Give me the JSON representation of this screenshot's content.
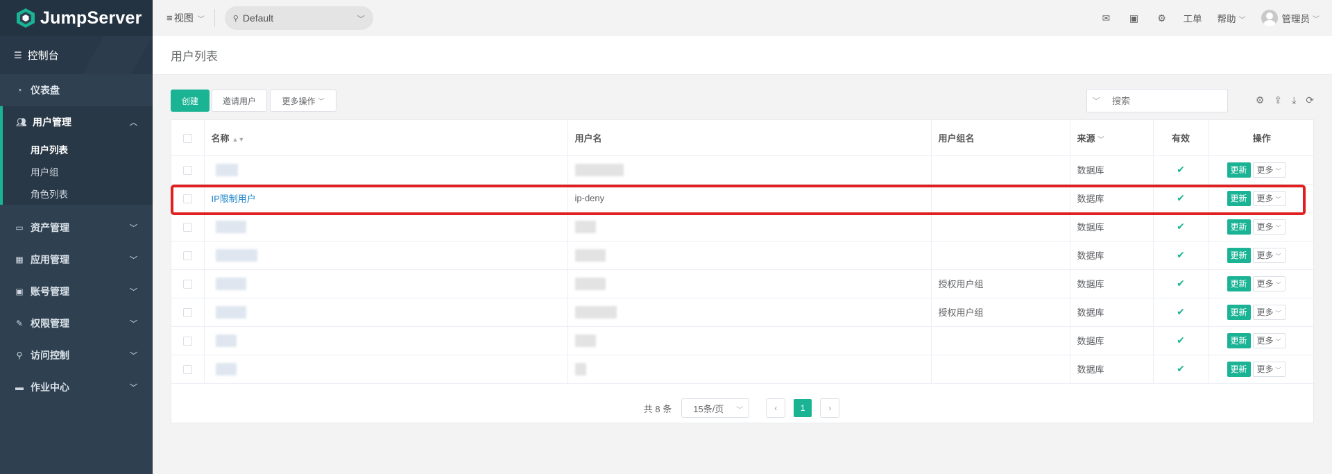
{
  "app": {
    "name": "JumpServer"
  },
  "sidebar": {
    "console": "控制台",
    "items": [
      {
        "label": "仪表盘",
        "icon": "dashboard-icon"
      },
      {
        "label": "用户管理",
        "icon": "users-icon",
        "open": true,
        "children": [
          {
            "label": "用户列表",
            "active": true
          },
          {
            "label": "用户组"
          },
          {
            "label": "角色列表"
          }
        ]
      },
      {
        "label": "资产管理",
        "icon": "inbox-icon"
      },
      {
        "label": "应用管理",
        "icon": "grid-icon"
      },
      {
        "label": "账号管理",
        "icon": "contact-icon"
      },
      {
        "label": "权限管理",
        "icon": "edit-icon"
      },
      {
        "label": "访问控制",
        "icon": "sitemap-icon"
      },
      {
        "label": "作业中心",
        "icon": "terminal-icon"
      }
    ]
  },
  "topbar": {
    "view_label": "视图",
    "org": "Default",
    "ticket_label": "工单",
    "help_label": "帮助",
    "user_label": "管理员"
  },
  "page": {
    "title": "用户列表"
  },
  "toolbar": {
    "create_label": "创建",
    "invite_label": "邀请用户",
    "more_actions_label": "更多操作",
    "search_placeholder": "搜索"
  },
  "table": {
    "columns": {
      "name": "名称",
      "username": "用户名",
      "group": "用户组名",
      "source": "来源",
      "valid": "有效",
      "actions": "操作"
    },
    "action_update": "更新",
    "action_more": "更多",
    "valid_mark": "✔",
    "rows": [
      {
        "name": "",
        "username": "",
        "group": "",
        "source": "数据库"
      },
      {
        "name": "IP限制用户",
        "username": "ip-deny",
        "group": "",
        "source": "数据库"
      },
      {
        "name": "",
        "username": "",
        "group": "",
        "source": "数据库"
      },
      {
        "name": "",
        "username": "",
        "group": "",
        "source": "数据库"
      },
      {
        "name": "",
        "username": "",
        "group": "授权用户组",
        "source": "数据库"
      },
      {
        "name": "",
        "username": "",
        "group": "授权用户组",
        "source": "数据库"
      },
      {
        "name": "",
        "username": "",
        "group": "",
        "source": "数据库"
      },
      {
        "name": "",
        "username": "",
        "group": "",
        "source": "数据库"
      }
    ]
  },
  "pagination": {
    "total": "共 8 条",
    "page_size": "15条/页",
    "current": "1"
  },
  "colors": {
    "sidebar": "#2f4050",
    "accent": "#1ab394",
    "link": "#1c84c6",
    "highlight": "#e02020"
  }
}
